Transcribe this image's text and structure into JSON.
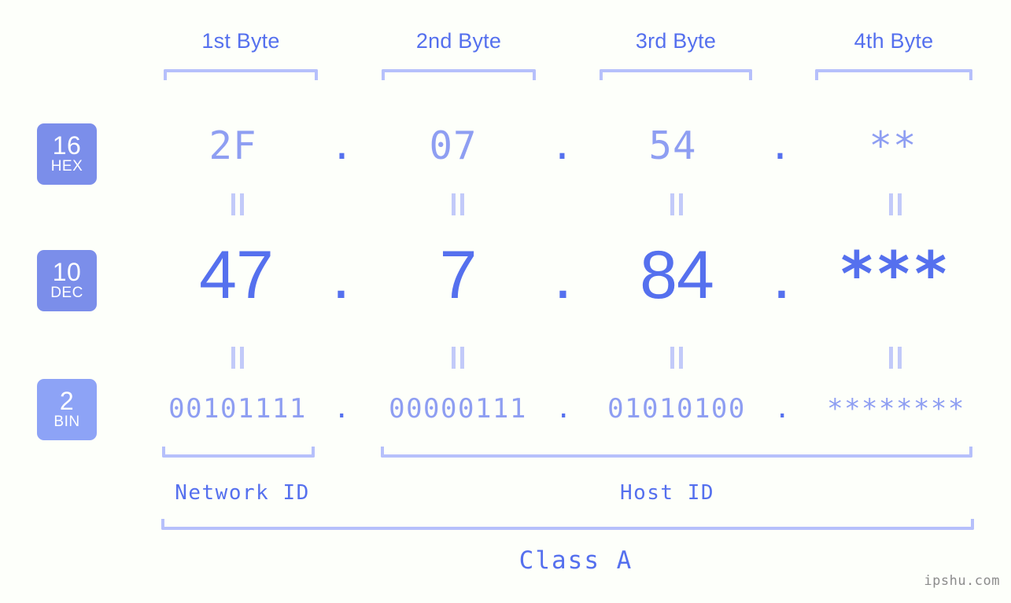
{
  "meta": {
    "background_color": "#fdfffa",
    "accent_strong": "#5570ee",
    "accent_mid": "#8e9ef2",
    "accent_light": "#b6c0fb",
    "badge_color": "#7b8eea",
    "badge_color_bin": "#8da3f6",
    "watermark": "ipshu.com"
  },
  "byte_headers": [
    {
      "label": "1st Byte"
    },
    {
      "label": "2nd Byte"
    },
    {
      "label": "3rd Byte"
    },
    {
      "label": "4th Byte"
    }
  ],
  "radix_badges": [
    {
      "number": "16",
      "name": "HEX"
    },
    {
      "number": "10",
      "name": "DEC"
    },
    {
      "number": "2",
      "name": "BIN"
    }
  ],
  "rows": {
    "hex": {
      "radix": "16",
      "radix_name": "HEX",
      "values": [
        "2F",
        "07",
        "54",
        "**"
      ],
      "separator": "."
    },
    "dec": {
      "radix": "10",
      "radix_name": "DEC",
      "values": [
        "47",
        "7",
        "84",
        "***"
      ],
      "separator": "."
    },
    "bin": {
      "radix": "2",
      "radix_name": "BIN",
      "values": [
        "00101111",
        "00000111",
        "01010100",
        "********"
      ],
      "separator": "."
    }
  },
  "equality_marker": "=",
  "partitions": {
    "network_id": "Network ID",
    "host_id": "Host ID",
    "class": "Class A"
  },
  "address": {
    "dotted_decimal": "47.7.84.***",
    "dotted_hex": "2F.07.54.**",
    "class": "Class A"
  }
}
